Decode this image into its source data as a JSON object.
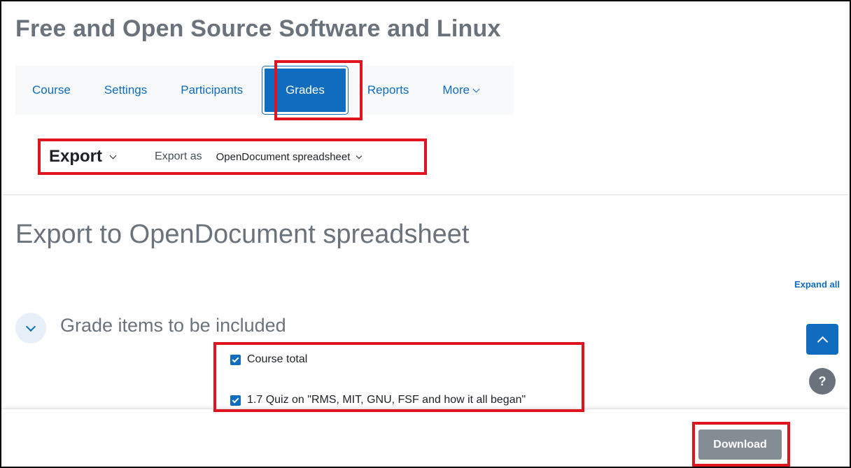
{
  "course": {
    "title": "Free and Open Source Software and Linux"
  },
  "nav": {
    "tabs": [
      {
        "label": "Course"
      },
      {
        "label": "Settings"
      },
      {
        "label": "Participants"
      },
      {
        "label": "Grades",
        "active": true
      },
      {
        "label": "Reports"
      },
      {
        "label": "More"
      }
    ]
  },
  "tertiary": {
    "title": "Export",
    "export_as_label": "Export as",
    "export_format": "OpenDocument spreadsheet"
  },
  "page": {
    "heading": "Export to OpenDocument spreadsheet",
    "expand_all": "Expand all",
    "section_legend": "Grade items to be included"
  },
  "grade_items": [
    {
      "label": "Course total",
      "checked": true
    },
    {
      "label": "1.7 Quiz on \"RMS, MIT, GNU, FSF and how it all began\"",
      "checked": true
    }
  ],
  "floating": {
    "help_label": "?"
  },
  "footer": {
    "download_label": "Download"
  },
  "colors": {
    "brand_blue": "#0f6cbf",
    "muted_heading": "#6a737b",
    "highlight_red": "#e0141e",
    "download_bg": "#858d94"
  }
}
